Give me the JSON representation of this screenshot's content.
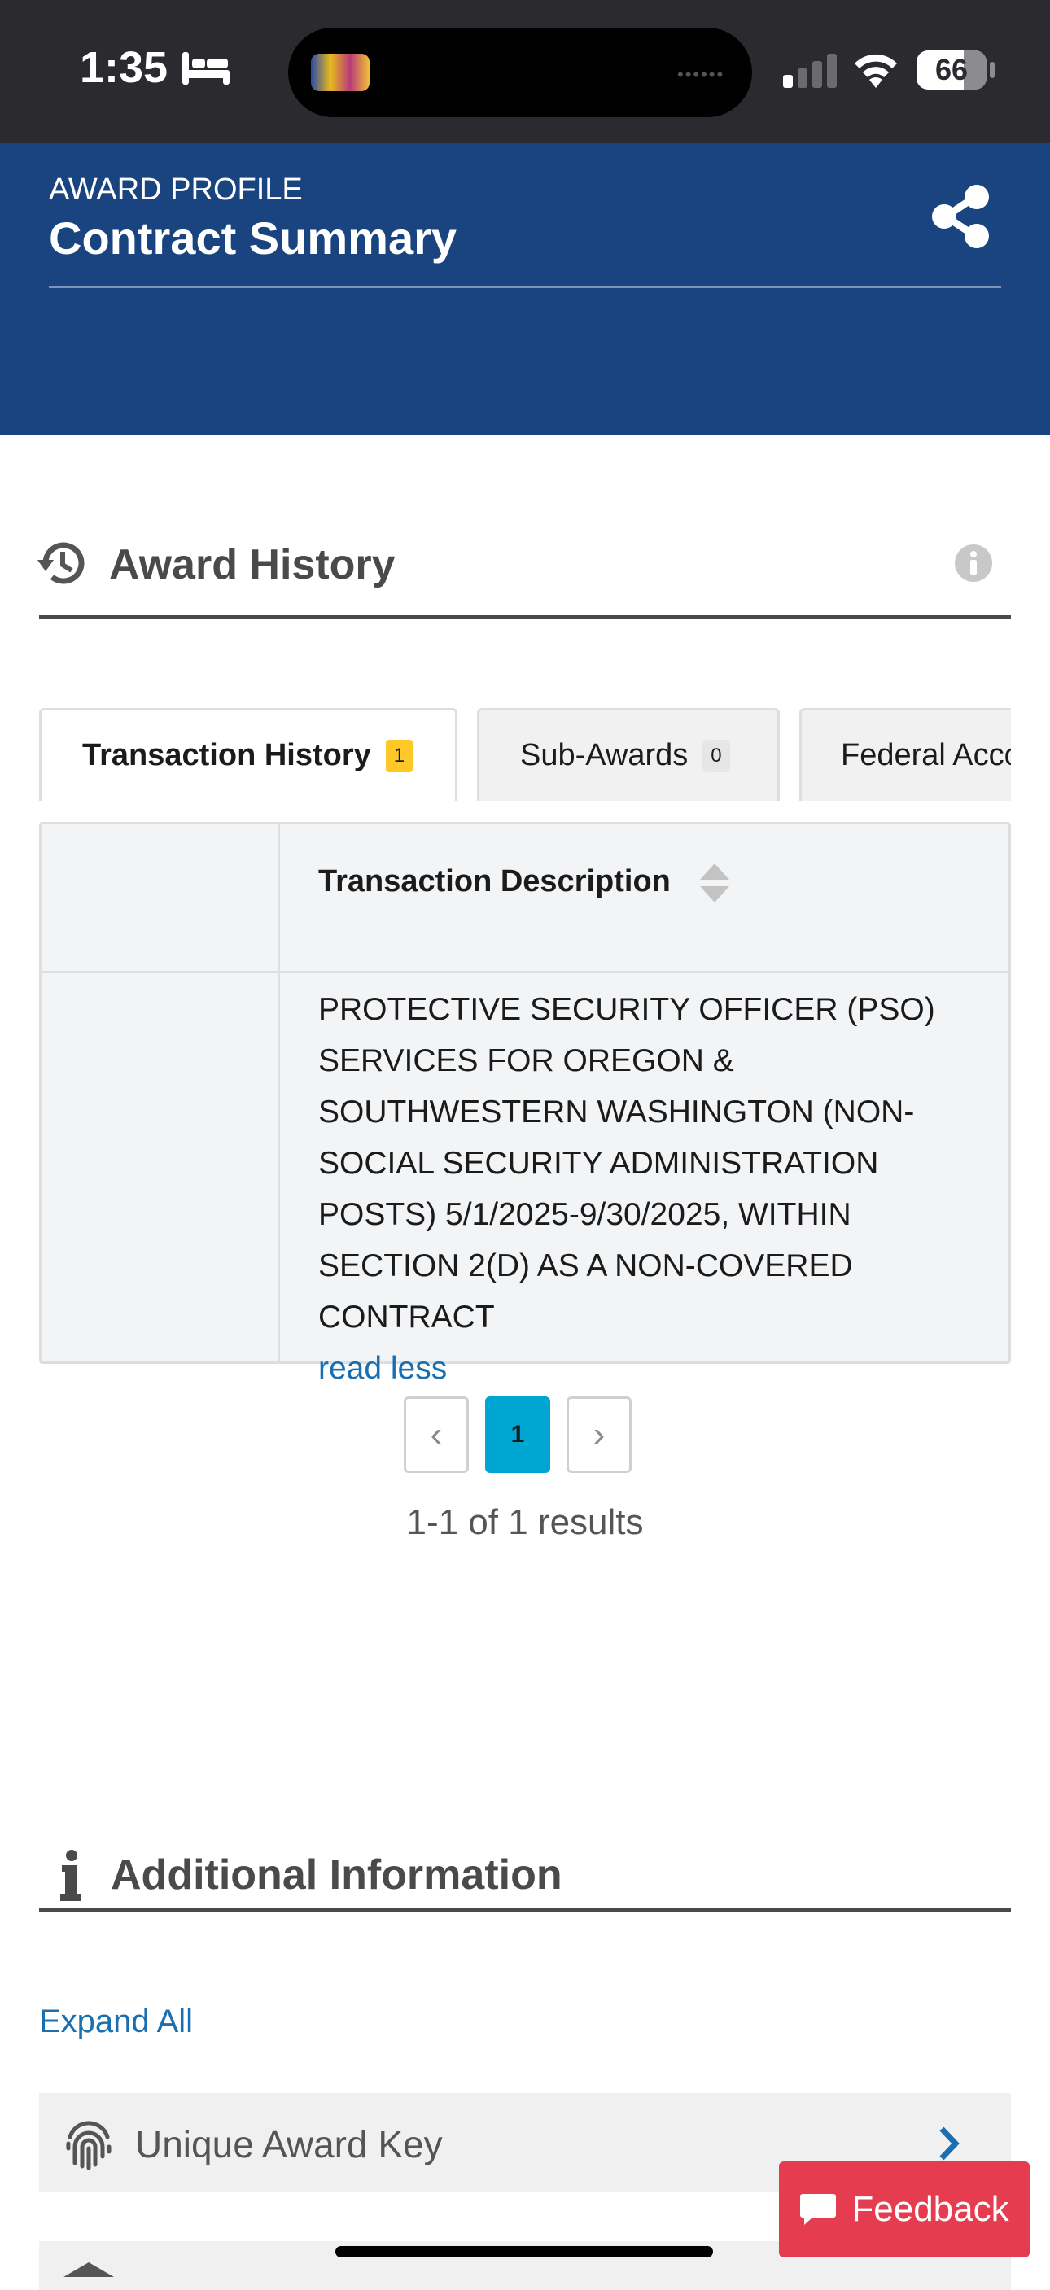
{
  "status_bar": {
    "time": "1:35",
    "battery": "66"
  },
  "header": {
    "eyebrow": "AWARD PROFILE",
    "title": "Contract Summary"
  },
  "award_history": {
    "title": "Award History",
    "tabs": [
      {
        "label": "Transaction History",
        "count": "1",
        "active": true
      },
      {
        "label": "Sub-Awards",
        "count": "0",
        "active": false
      },
      {
        "label": "Federal Acco",
        "count": "",
        "active": false
      }
    ],
    "table": {
      "column_header": "Transaction Description",
      "rows": [
        {
          "description": "PROTECTIVE SECURITY OFFICER (PSO) SERVICES FOR OREGON & SOUTHWESTERN WASHINGTON (NON-SOCIAL SECURITY ADMINISTRATION POSTS) 5/1/2025-9/30/2025, WITHIN SECTION 2(D) AS A NON-COVERED CONTRACT",
          "toggle": "read less"
        }
      ]
    },
    "pagination": {
      "prev": "‹",
      "current": "1",
      "next": "›",
      "results": "1-1 of 1 results"
    }
  },
  "additional_information": {
    "title": "Additional Information",
    "expand_all": "Expand All",
    "items": [
      {
        "label": "Unique Award Key"
      }
    ]
  },
  "feedback": {
    "label": "Feedback"
  },
  "colors": {
    "header_bg": "#1a4480",
    "status_bg": "#2b2b2f",
    "link": "#1a6fb0",
    "active_page": "#00a6d2",
    "badge_highlight": "#fdc828",
    "feedback_bg": "#e63c50"
  }
}
